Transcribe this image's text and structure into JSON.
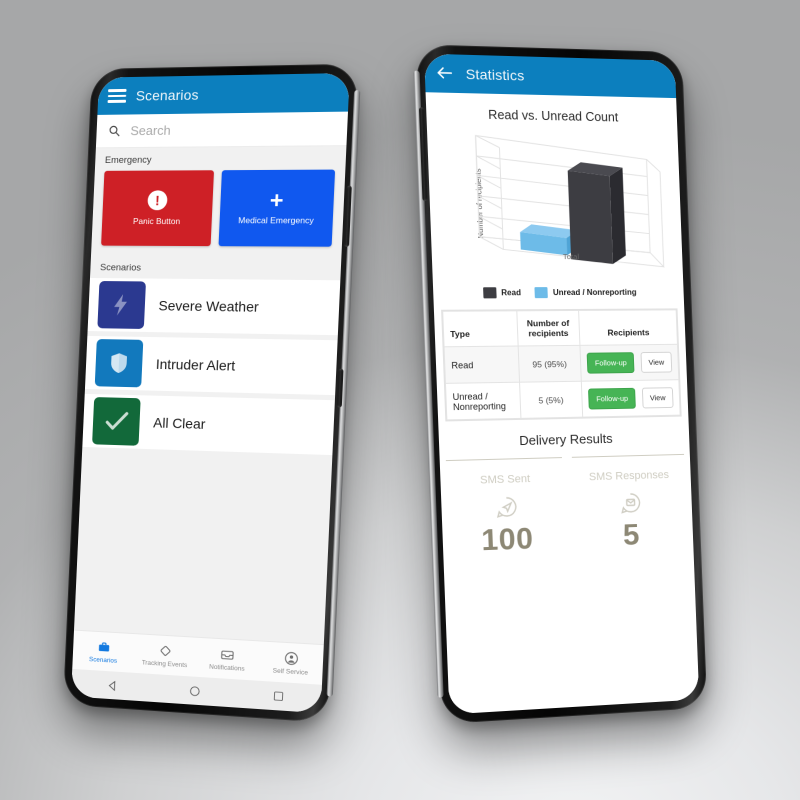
{
  "scene": {
    "background_top": "#a8a9aa",
    "background_bottom": "#f2f3f4"
  },
  "phone_left": {
    "appbar": {
      "title": "Scenarios",
      "menu_icon": "hamburger-icon",
      "color": "#0c7fbe"
    },
    "search": {
      "placeholder": "Search",
      "icon": "search-icon"
    },
    "sections": [
      {
        "label": "Emergency"
      },
      {
        "label": "Scenarios"
      }
    ],
    "emergency_tiles": [
      {
        "label": "Panic Button",
        "color": "#ce2026",
        "icon": "exclamation-circle-icon"
      },
      {
        "label": "Medical Emergency",
        "color": "#1058ef",
        "icon": "medical-plus-icon"
      }
    ],
    "scenario_list": [
      {
        "label": "Severe Weather",
        "color": "#2b3990",
        "icon": "lightning-bolt-icon"
      },
      {
        "label": "Intruder Alert",
        "color": "#1279bd",
        "icon": "shield-icon"
      },
      {
        "label": "All Clear",
        "color": "#12693a",
        "icon": "checkmark-icon"
      }
    ],
    "bottom_nav": [
      {
        "label": "Scenarios",
        "icon": "briefcase-icon",
        "active": true
      },
      {
        "label": "Tracking Events",
        "icon": "diamond-icon",
        "active": false
      },
      {
        "label": "Notifications",
        "icon": "inbox-icon",
        "active": false
      },
      {
        "label": "Self Service",
        "icon": "user-circle-icon",
        "active": false
      }
    ],
    "system_nav": [
      {
        "icon": "back-triangle-icon"
      },
      {
        "icon": "home-circle-icon"
      },
      {
        "icon": "recents-square-icon"
      }
    ]
  },
  "phone_right": {
    "appbar": {
      "title": "Statistics",
      "back_icon": "arrow-left-icon",
      "color": "#0c7fbe"
    },
    "table": {
      "headers": [
        "Type",
        "Number of recipients",
        "Recipients"
      ],
      "rows": [
        {
          "type": "Read",
          "count": "95 (95%)",
          "followup_label": "Follow-up",
          "view_label": "View"
        },
        {
          "type": "Unread / Nonreporting",
          "count": "5 (5%)",
          "followup_label": "Follow-up",
          "view_label": "View"
        }
      ],
      "followup_color": "#46b455"
    },
    "delivery": {
      "title": "Delivery Results",
      "cells": [
        {
          "name": "SMS Sent",
          "value": "100",
          "icon": "send-plane-icon"
        },
        {
          "name": "SMS Responses",
          "value": "5",
          "icon": "chat-bubble-icon"
        }
      ]
    }
  },
  "chart_data": {
    "type": "bar",
    "title": "Read vs. Unread Count",
    "xlabel": "Total",
    "ylabel": "Number of recipients",
    "categories": [
      "Total"
    ],
    "series": [
      {
        "name": "Read",
        "values": [
          95
        ],
        "color": "#3d3d42"
      },
      {
        "name": "Unread / Nonreporting",
        "values": [
          5
        ],
        "color": "#6dbbe8"
      }
    ],
    "ylim": [
      0,
      100
    ],
    "yticks": [
      0,
      20,
      40,
      60,
      80,
      100
    ],
    "grid": true,
    "legend_position": "bottom",
    "three_d": true,
    "tick_labels_visible": false
  }
}
